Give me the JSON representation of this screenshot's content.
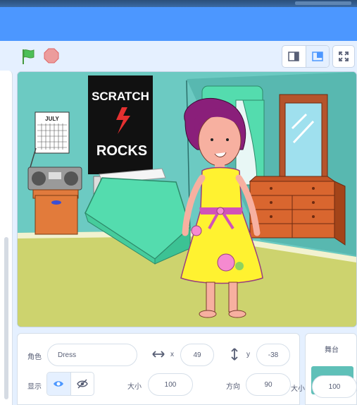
{
  "controls": {
    "flag_icon": "green-flag-icon",
    "stop_icon": "stop-icon"
  },
  "sprite": {
    "name_label": "角色",
    "name_value": "Dress",
    "x_label": "x",
    "x_value": "49",
    "y_label": "y",
    "y_value": "-38",
    "show_label": "显示",
    "size_label": "大小",
    "size_value": "100",
    "direction_label": "方向",
    "direction_value": "90"
  },
  "stage_panel": {
    "title": "舞台"
  },
  "overlay": {
    "size_label": "大小",
    "size_value": "100"
  },
  "scene": {
    "poster_line1": "SCRATCH",
    "poster_line2": "ROCKS",
    "calendar_month": "JULY"
  },
  "colors": {
    "accent": "#4c97ff",
    "panel_bg": "#e5f0ff",
    "wall": "#5fc0b8",
    "floor": "#cdd36e"
  }
}
